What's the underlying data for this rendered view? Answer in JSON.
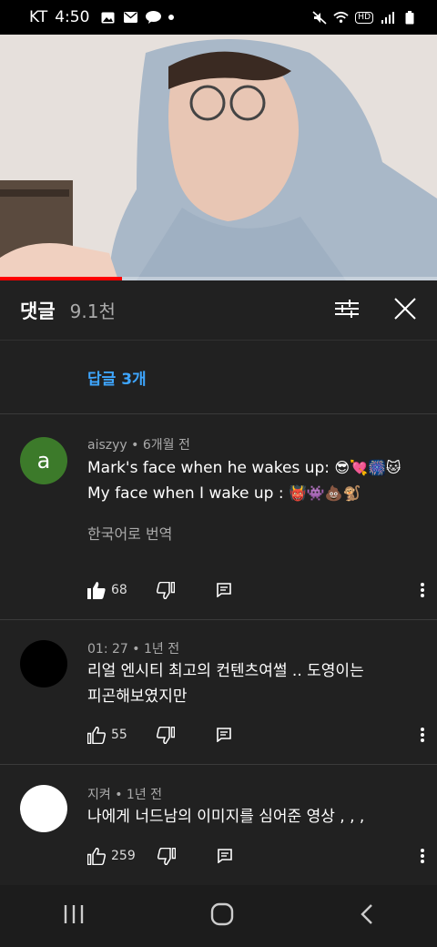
{
  "status": {
    "carrier": "KT",
    "time": "4:50"
  },
  "video": {
    "progress_fraction": 0.28
  },
  "header": {
    "title": "댓글",
    "count": "9.1천"
  },
  "replies": {
    "label": "답글 3개"
  },
  "comments": [
    {
      "avatar_letter": "a",
      "avatar_color": "#3c7a2a",
      "meta": "aiszyy • 6개월 전",
      "line1": "Mark's face when he wakes up: ",
      "line1_emoji": "😎💘🎆🐱",
      "line2": "My face when I wake up : ",
      "line2_emoji": "👹👾💩🐒",
      "translate": "한국어로 번역",
      "likes": "68"
    },
    {
      "avatar_color": "#000000",
      "meta": "01: 27 • 1년 전",
      "line1": "리얼 엔시티 최고의 컨텐츠여썰 .. 도영이는",
      "line2": "피곤해보였지만",
      "likes": "55"
    },
    {
      "avatar_color": "#ffffff",
      "meta": "지켜 • 1년 전",
      "line1": "나에게 너드남의 이미지를 심어준 영상 , , ,",
      "likes": "259"
    }
  ]
}
